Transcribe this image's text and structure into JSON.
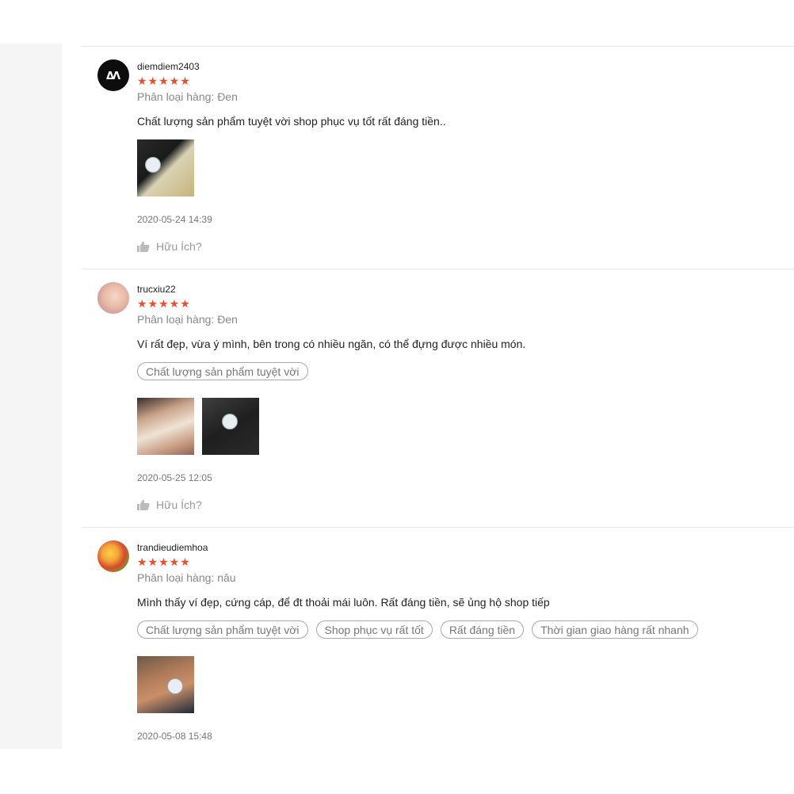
{
  "reviews": [
    {
      "username": "diemdiem2403",
      "avatar_icon": "avatar-initials-icon",
      "stars": "★★★★★",
      "rating": 5,
      "variation": "Phân loại hàng: Đen",
      "comment": "Chất lượng sản phẩm tuyệt vời shop phục vụ tốt rất đáng tiền..",
      "tags": [],
      "photo_count": 1,
      "date": "2020-05-24 14:39",
      "helpful_label": "Hữu Ích?"
    },
    {
      "username": "trucxiu22",
      "avatar_icon": "avatar-photo-icon",
      "stars": "★★★★★",
      "rating": 5,
      "variation": "Phân loại hàng: Đen",
      "comment": "Ví rất đẹp, vừa ý mình, bên trong có nhiều ngăn, có thể đựng được nhiều món.",
      "tags": [
        "Chất lượng sản phẩm tuyệt vời"
      ],
      "photo_count": 2,
      "date": "2020-05-25 12:05",
      "helpful_label": "Hữu Ích?"
    },
    {
      "username": "trandieudiemhoa",
      "avatar_icon": "avatar-photo-icon",
      "stars": "★★★★★",
      "rating": 5,
      "variation": "Phân loại hàng: nâu",
      "comment": "Mình thấy ví đẹp, cứng cáp, để đt thoải mái luôn. Rất đáng tiền, sẽ ủng hộ shop tiếp",
      "tags": [
        "Chất lượng sản phẩm tuyệt vời",
        "Shop phục vụ rất tốt",
        "Rất đáng tiền",
        "Thời gian giao hàng rất nhanh"
      ],
      "photo_count": 1,
      "date": "2020-05-08 15:48"
    }
  ],
  "colors": {
    "star": "#ee4d2d",
    "muted_text": "#888888",
    "divider": "#e8e8e8"
  }
}
